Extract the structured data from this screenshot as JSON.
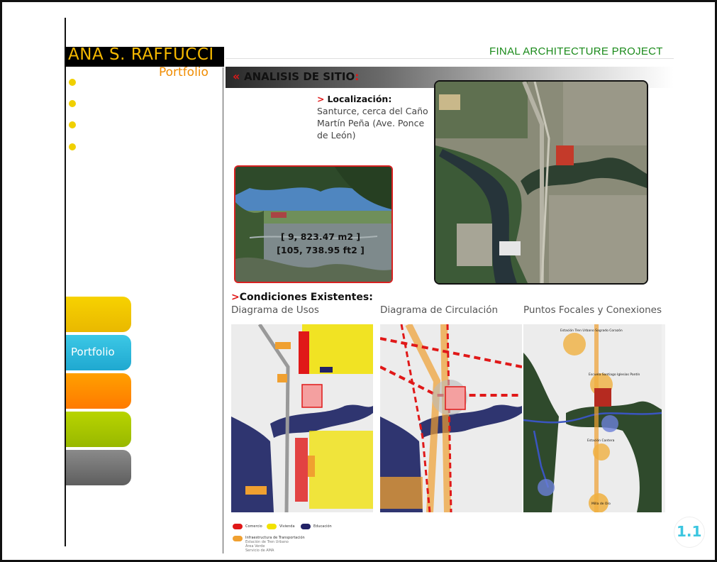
{
  "header": {
    "name": "ANA S. RAFFUCCI",
    "subtitle": "Portfolio",
    "project_title": "FINAL ARCHITECTURE PROJECT"
  },
  "nav": {
    "tabs": [
      {
        "label": "",
        "color": "#f2c500"
      },
      {
        "label": "Portfolio",
        "color": "#2bb8dc"
      },
      {
        "label": "",
        "color": "#ff8a00"
      },
      {
        "label": "",
        "color": "#a9c400"
      },
      {
        "label": "",
        "color": "#777777"
      }
    ]
  },
  "section": {
    "title": "ANALISIS DE SITIO",
    "colon": ":"
  },
  "location": {
    "arrow": ">",
    "label": "Localización:",
    "text": "Santurce, cerca del Caño Martín Peña (Ave. Ponce de León)"
  },
  "photo": {
    "area_m2": "[ 9, 823.47 m2 ]",
    "area_ft2": "[105, 738.95 ft2 ]"
  },
  "conditions": {
    "arrow": ">",
    "title": "Condiciones Existentes:",
    "diagrams": [
      {
        "label": "Diagrama de Usos"
      },
      {
        "label": "Diagrama de Circulación"
      },
      {
        "label": "Puntos Focales y Conexiones"
      }
    ]
  },
  "focal_points": {
    "labels": [
      "Estación Tren Urbano Sagrado Corazón",
      "Escuela Santiago Iglesias Pantín",
      "Estación Cantera",
      "Milla de Oro"
    ]
  },
  "legend": {
    "items": [
      {
        "label": "Comercio",
        "color": "#e01818"
      },
      {
        "label": "Vivienda",
        "color": "#f2e200"
      },
      {
        "label": "Educación",
        "color": "#222266"
      },
      {
        "label": "Infraestructura de Transportación",
        "color": "#f0a030"
      }
    ],
    "sub_items": [
      "Estación de Tren Urbano",
      "Área Verde",
      "Servicio de AMA"
    ]
  },
  "page": {
    "number": "1.1"
  }
}
